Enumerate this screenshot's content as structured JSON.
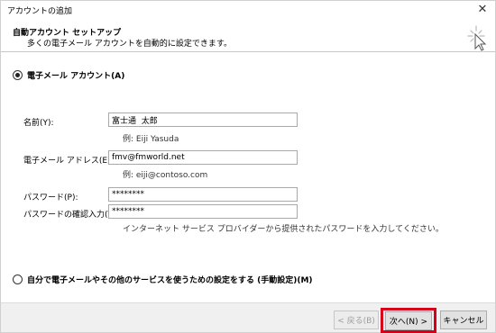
{
  "window": {
    "title": "アカウントの追加",
    "close_glyph": "✕"
  },
  "header": {
    "title": "自動アカウント セットアップ",
    "subtitle": "多くの電子メール アカウントを自動的に設定できます。",
    "icon": "wizard-sparkle-icon"
  },
  "email_option": {
    "label": "電子メール アカウント(A)",
    "selected": true
  },
  "fields": {
    "name": {
      "label": "名前(Y):",
      "value": "富士通  太郎",
      "hint": "例: Eiji Yasuda"
    },
    "email": {
      "label": "電子メール アドレス(E):",
      "value": "fmv@fmworld.net",
      "hint": "例: eiji@contoso.com"
    },
    "password": {
      "label": "パスワード(P):",
      "value": "********"
    },
    "password_confirm": {
      "label": "パスワードの確認入力(T):",
      "value": "********"
    },
    "password_note": "インターネット サービス プロバイダーから提供されたパスワードを入力してください。"
  },
  "manual_option": {
    "label": "自分で電子メールやその他のサービスを使うための設定をする (手動設定)(M)",
    "selected": false
  },
  "buttons": {
    "back": "< 戻る(B)",
    "next": "次へ(N) >",
    "cancel": "キャンセル"
  },
  "colors": {
    "highlight": "#d7001b",
    "footer_bg": "#f0f0f0"
  }
}
